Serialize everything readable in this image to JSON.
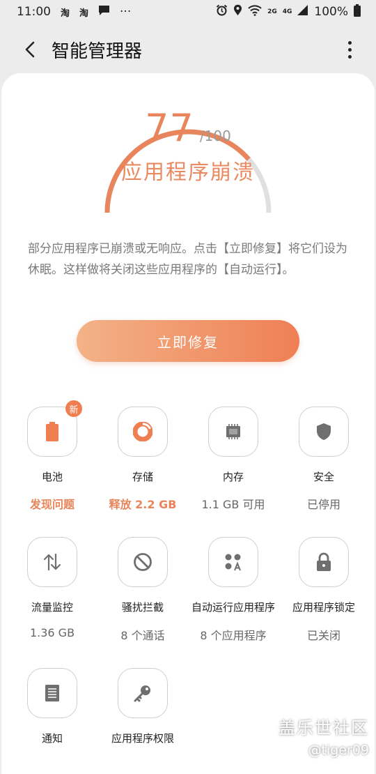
{
  "status_bar": {
    "time": "11:00",
    "notif_1": "淘",
    "notif_2": "淘",
    "more_dots": "···",
    "network_2g": "2G",
    "network_4g": "4G",
    "battery_percent": "100%"
  },
  "header": {
    "title": "智能管理器"
  },
  "score": {
    "value": "77",
    "max": "/100",
    "progress_fraction": 0.77,
    "status": "应用程序崩溃"
  },
  "description": "部分应用程序已崩溃或无响应。点击【立即修复】将它们设为休眠。这样做将关闭这些应用程序的【自动运行】。",
  "fix_button": "立即修复",
  "items": [
    {
      "label": "电池",
      "value": "发现问题",
      "icon": "battery-icon",
      "badge": "新",
      "alert": true
    },
    {
      "label": "存储",
      "value": "释放 2.2 GB",
      "icon": "storage-icon",
      "alert": true
    },
    {
      "label": "内存",
      "value": "1.1 GB 可用",
      "icon": "memory-icon"
    },
    {
      "label": "安全",
      "value": "已停用",
      "icon": "shield-icon"
    },
    {
      "label": "流量监控",
      "value": "1.36 GB",
      "icon": "data-usage-icon"
    },
    {
      "label": "骚扰拦截",
      "value": "8 个通话",
      "icon": "block-icon"
    },
    {
      "label": "自动运行应用程序",
      "value": "8 个应用程序",
      "icon": "auto-run-icon"
    },
    {
      "label": "应用程序锁定",
      "value": "已关闭",
      "icon": "lock-icon"
    },
    {
      "label": "通知",
      "icon": "notification-icon"
    },
    {
      "label": "应用程序权限",
      "icon": "key-icon"
    }
  ],
  "colors": {
    "accent": "#e8855c",
    "accent_light": "#f3b287",
    "icon_gray": "#6f6f6f"
  },
  "watermark": {
    "line1": "盖乐世社区",
    "line2": "@tiger09"
  }
}
